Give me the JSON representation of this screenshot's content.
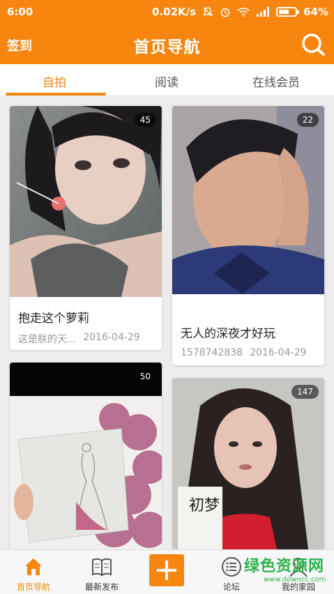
{
  "status_bar": {
    "time": "6:00",
    "speed": "0.02K/s",
    "battery": "64%",
    "battery_level": 0.64
  },
  "header": {
    "left_action": "签到",
    "title": "首页导航"
  },
  "tabs": [
    {
      "label": "自拍",
      "active": true
    },
    {
      "label": "阅读",
      "active": false
    },
    {
      "label": "在线会员",
      "active": false
    }
  ],
  "cards": [
    {
      "count": "45",
      "title": "抱走这个萝莉",
      "author": "这是朕的天...",
      "date": "2016-04-29"
    },
    {
      "count": "22",
      "title": "无人的深夜才好玩",
      "author": "1578742838",
      "date": "2016-04-29"
    },
    {
      "count": "50"
    },
    {
      "count": "147",
      "photo_caption": "初梦"
    }
  ],
  "bottom_nav": [
    {
      "label": "首页导航",
      "icon": "home-icon",
      "active": true
    },
    {
      "label": "最新发布",
      "icon": "book-icon",
      "active": false
    },
    {
      "label": "",
      "icon": "plus-icon",
      "active": false
    },
    {
      "label": "论坛",
      "icon": "list-icon",
      "active": false
    },
    {
      "label": "我的家园",
      "icon": "user-icon",
      "active": false
    }
  ],
  "watermark": {
    "text": "绿色资源网",
    "url": "www.downcc.com"
  },
  "colors": {
    "accent": "#f6860f",
    "watermark": "#2bb34a"
  }
}
